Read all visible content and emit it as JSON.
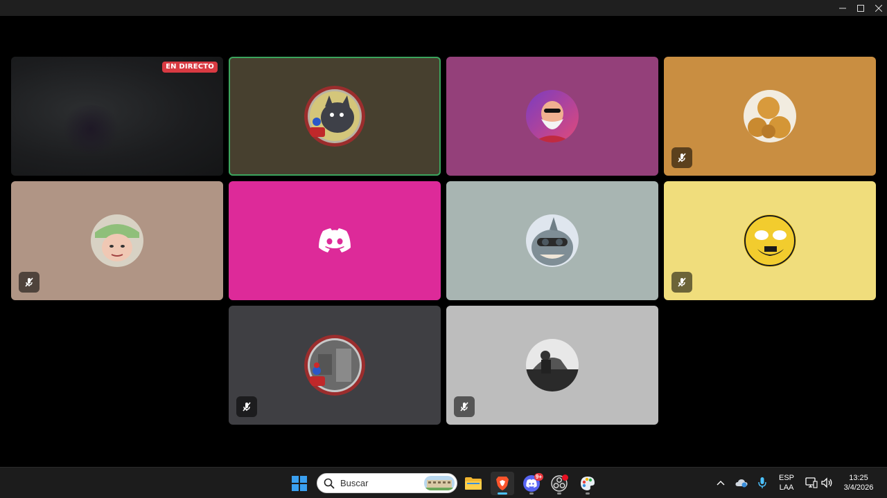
{
  "window": {
    "controls": [
      "minimize-icon",
      "maximize-icon",
      "close-icon"
    ]
  },
  "call": {
    "live_badge": "EN DIRECTO",
    "tiles": [
      {
        "id": "stream",
        "bg": "#1e1f20",
        "live": true
      },
      {
        "id": "p2",
        "bg": "#47402f",
        "avatar": "cat-pokeball",
        "speaking": true,
        "muted": false
      },
      {
        "id": "p3",
        "bg": "#94407a",
        "avatar": "old-man-sunglasses",
        "muted": false
      },
      {
        "id": "p4",
        "bg": "#c98e41",
        "avatar": "pastries",
        "muted": true
      },
      {
        "id": "p5",
        "bg": "#b09585",
        "avatar": "person-hat",
        "muted": true
      },
      {
        "id": "p6",
        "bg": "#dd2a99",
        "avatar": "discord-default",
        "muted": false
      },
      {
        "id": "p7",
        "bg": "#a8b5b2",
        "avatar": "shark-goggles",
        "muted": false
      },
      {
        "id": "p8",
        "bg": "#f0dd7c",
        "avatar": "sunglasses-face",
        "muted": true
      },
      {
        "id": "p9",
        "bg": "#3f3f43",
        "avatar": "mario-figure",
        "muted": true
      },
      {
        "id": "p10",
        "bg": "#bdbdbd",
        "avatar": "bw-photo",
        "muted": true
      }
    ]
  },
  "taskbar": {
    "search_placeholder": "Buscar",
    "apps": [
      "windows-start-icon",
      "file-explorer-icon",
      "brave-browser-icon",
      "discord-icon",
      "obs-icon",
      "paint-icon"
    ],
    "discord_badge": "9+",
    "language_line1": "ESP",
    "language_line2": "LAA",
    "time": "13:25",
    "date": "3/4/2026"
  },
  "colors": {
    "speaking_ring": "#3ba55d",
    "live_badge": "#d83a42",
    "accent": "#4cc2ff"
  }
}
